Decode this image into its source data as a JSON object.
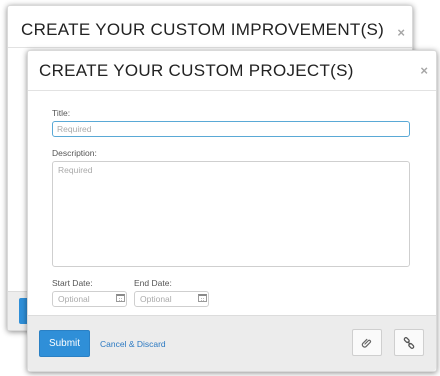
{
  "back_modal": {
    "title": "CREATE YOUR CUSTOM IMPROVEMENT(S)",
    "close": "×"
  },
  "front_modal": {
    "title": "CREATE YOUR CUSTOM PROJECT(S)",
    "close": "×",
    "fields": {
      "title_label": "Title:",
      "title_placeholder": "Required",
      "description_label": "Description:",
      "description_placeholder": "Required",
      "start_date_label": "Start Date:",
      "start_date_placeholder": "Optional",
      "end_date_label": "End Date:",
      "end_date_placeholder": "Optional"
    },
    "footer": {
      "submit_label": "Submit",
      "cancel_label": "Cancel & Discard",
      "attach_icon": "paperclip-icon",
      "link_icon": "link-icon"
    }
  },
  "colors": {
    "primary": "#2f8fd8",
    "link": "#2b79c2",
    "focus_border": "#5aa9d6"
  }
}
